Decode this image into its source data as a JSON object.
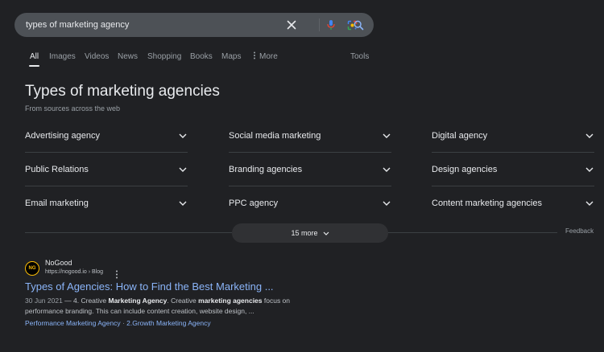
{
  "search": {
    "query": "types of marketing agency"
  },
  "tabs": [
    {
      "label": "All"
    },
    {
      "label": "Images"
    },
    {
      "label": "Videos"
    },
    {
      "label": "News"
    },
    {
      "label": "Shopping"
    },
    {
      "label": "Books"
    },
    {
      "label": "Maps"
    },
    {
      "label": "More"
    }
  ],
  "tools_label": "Tools",
  "panel": {
    "title": "Types of marketing agencies",
    "subtitle": "From sources across the web",
    "items": [
      {
        "label": "Advertising agency"
      },
      {
        "label": "Social media marketing"
      },
      {
        "label": "Digital agency"
      },
      {
        "label": "Public Relations"
      },
      {
        "label": "Branding agencies"
      },
      {
        "label": "Design agencies"
      },
      {
        "label": "Email marketing"
      },
      {
        "label": "PPC agency"
      },
      {
        "label": "Content marketing agencies"
      }
    ],
    "more_label": "15 more",
    "feedback_label": "Feedback"
  },
  "result": {
    "favicon_text": "NG",
    "site_name": "NoGood",
    "site_url": "https://nogood.io › Blog",
    "title": "Types of Agencies: How to Find the Best Marketing ...",
    "date": "30 Jun 2021",
    "snippet_parts": {
      "p1": " — 4. Creative ",
      "b1": "Marketing Agency",
      "p2": ". Creative ",
      "b2": "marketing agencies",
      "p3": " focus on performance branding. This can include content creation, website design, ..."
    },
    "sitelink_1": "Performance Marketing Agency",
    "sitelink_sep": " · ",
    "sitelink_2": "2.Growth Marketing Agency"
  },
  "colors": {
    "background": "#202124",
    "link": "#8ab4f8",
    "search_bar": "#4d5156"
  }
}
